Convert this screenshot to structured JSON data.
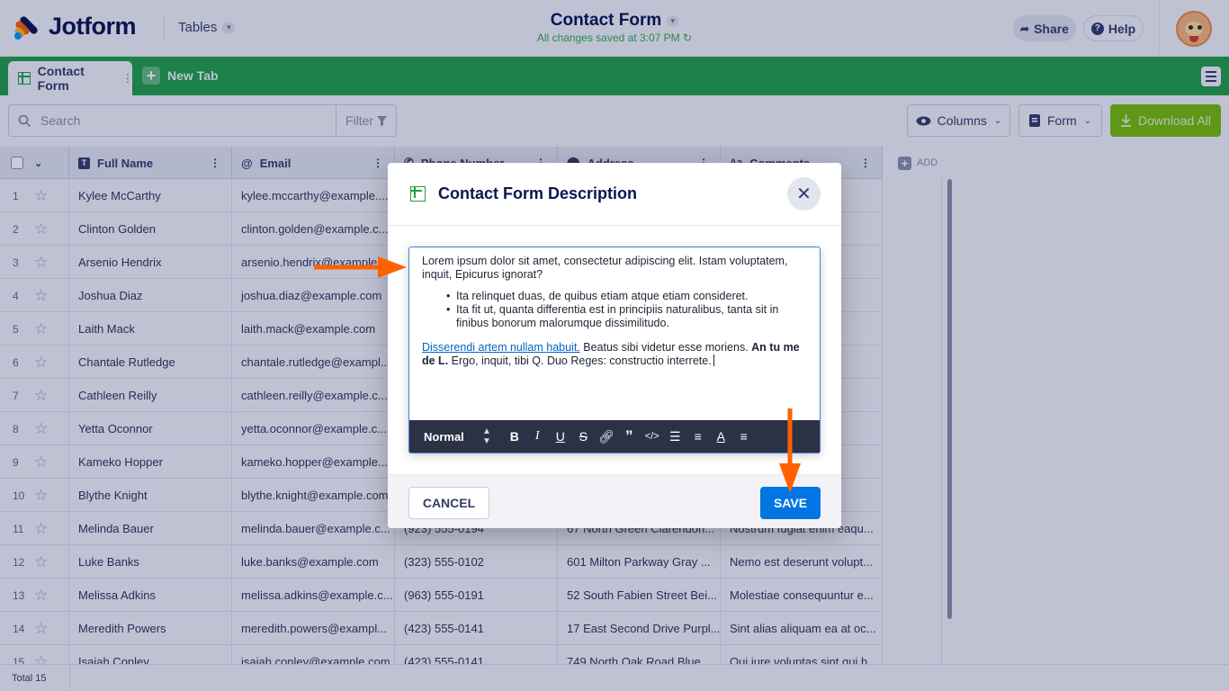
{
  "app": {
    "brand": "Jotform",
    "section": "Tables",
    "title": "Contact Form",
    "saved_status": "All changes saved at 3:07 PM",
    "share_label": "Share",
    "help_label": "Help"
  },
  "tabs": {
    "active": "Contact Form",
    "new_tab": "New Tab"
  },
  "toolbar": {
    "search_placeholder": "Search",
    "filter_label": "Filter",
    "columns_label": "Columns",
    "form_label": "Form",
    "download_label": "Download All"
  },
  "table": {
    "headers": [
      "Full Name",
      "Email",
      "Phone Number",
      "Address",
      "Comments"
    ],
    "add_label": "ADD",
    "rows": [
      {
        "n": "1",
        "name": "Kylee McCarthy",
        "email": "kylee.mccarthy@example....",
        "phone": "",
        "address": "",
        "comments": "on la..."
      },
      {
        "n": "2",
        "name": "Clinton Golden",
        "email": "clinton.golden@example.c...",
        "phone": "",
        "address": "",
        "comments": "nulla..."
      },
      {
        "n": "3",
        "name": "Arsenio Hendrix",
        "email": "arsenio.hendrix@example...",
        "phone": "",
        "address": "",
        "comments": "d qu..."
      },
      {
        "n": "4",
        "name": "Joshua Diaz",
        "email": "joshua.diaz@example.com",
        "phone": "",
        "address": "",
        "comments": "s su..."
      },
      {
        "n": "5",
        "name": "Laith Mack",
        "email": "laith.mack@example.com",
        "phone": "",
        "address": "",
        "comments": "r ani..."
      },
      {
        "n": "6",
        "name": "Chantale Rutledge",
        "email": "chantale.rutledge@exampl...",
        "phone": "",
        "address": "",
        "comments": "onse..."
      },
      {
        "n": "7",
        "name": "Cathleen Reilly",
        "email": "cathleen.reilly@example.c...",
        "phone": "",
        "address": "",
        "comments": "re ra..."
      },
      {
        "n": "8",
        "name": "Yetta Oconnor",
        "email": "yetta.oconnor@example.c...",
        "phone": "",
        "address": "",
        "comments": "ostr..."
      },
      {
        "n": "9",
        "name": "Kameko Hopper",
        "email": "kameko.hopper@example....",
        "phone": "",
        "address": "",
        "comments": "int q..."
      },
      {
        "n": "10",
        "name": "Blythe Knight",
        "email": "blythe.knight@example.com",
        "phone": "",
        "address": "",
        "comments": "cept..."
      },
      {
        "n": "11",
        "name": "Melinda Bauer",
        "email": "melinda.bauer@example.c...",
        "phone": "(923) 555-0194",
        "address": "67 North Green Clarendon...",
        "comments": "Nostrum fugiat enim eaqu..."
      },
      {
        "n": "12",
        "name": "Luke Banks",
        "email": "luke.banks@example.com",
        "phone": "(323) 555-0102",
        "address": "601 Milton Parkway Gray ...",
        "comments": "Nemo est deserunt volupt..."
      },
      {
        "n": "13",
        "name": "Melissa Adkins",
        "email": "melissa.adkins@example.c...",
        "phone": "(963) 555-0191",
        "address": "52 South Fabien Street Bei...",
        "comments": "Molestiae consequuntur e..."
      },
      {
        "n": "14",
        "name": "Meredith Powers",
        "email": "meredith.powers@exampl...",
        "phone": "(423) 555-0141",
        "address": "17 East Second Drive Purpl...",
        "comments": "Sint alias aliquam ea at oc..."
      },
      {
        "n": "15",
        "name": "Isaiah Conley",
        "email": "isaiah.conley@example.com",
        "phone": "(423) 555-0141",
        "address": "749 North Oak Road Blue ...",
        "comments": "Qui iure voluptas sint qui h..."
      }
    ],
    "total_label": "Total 15"
  },
  "modal": {
    "title": "Contact Form Description",
    "para1": "Lorem ipsum dolor sit amet, consectetur adipiscing elit. Istam voluptatem, inquit, Epicurus ignorat?",
    "bullets": [
      "Ita relinquet duas, de quibus etiam atque etiam consideret.",
      "Ita fit ut, quanta differentia est in principiis naturalibus, tanta sit in finibus bonorum malorumque dissimilitudo."
    ],
    "link_text": "Disserendi artem nullam habuit.",
    "para2_a": " Beatus sibi videtur esse moriens. ",
    "para2_bold": "An tu me de L.",
    "para2_b": " Ergo, inquit, tibi Q. Duo Reges: constructio interrete.",
    "format_label": "Normal",
    "cancel_label": "CANCEL",
    "save_label": "SAVE"
  },
  "colors": {
    "accent_green": "#239e46",
    "save_blue": "#0075e3",
    "annotation_arrow": "#ff6100"
  }
}
